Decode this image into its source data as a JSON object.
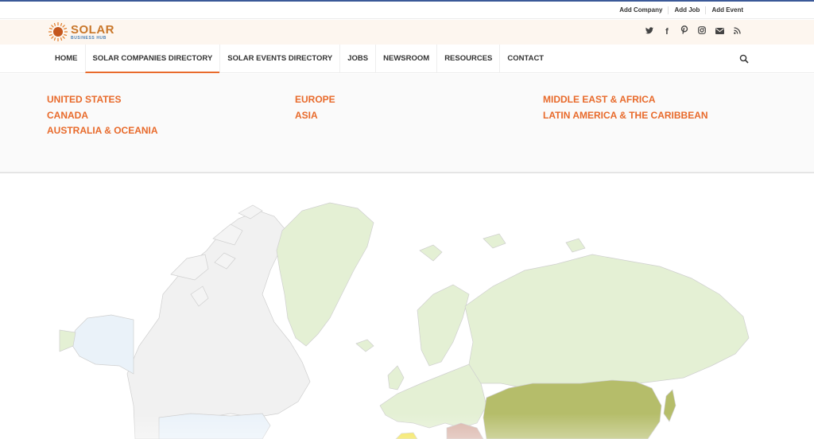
{
  "topbar": {
    "links": [
      "Add Company",
      "Add Job",
      "Add Event"
    ]
  },
  "brand": {
    "name": "SOLAR",
    "tagline": "BUSINESS HUB"
  },
  "social_icons": [
    "twitter-icon",
    "facebook-icon",
    "pinterest-icon",
    "instagram-icon",
    "mail-icon",
    "rss-icon"
  ],
  "nav": {
    "items": [
      "HOME",
      "SOLAR COMPANIES DIRECTORY",
      "SOLAR EVENTS DIRECTORY",
      "JOBS",
      "NEWSROOM",
      "RESOURCES",
      "CONTACT"
    ],
    "active": "SOLAR COMPANIES DIRECTORY"
  },
  "regions": {
    "col1": [
      "UNITED STATES",
      "CANADA",
      "AUSTRALIA & OCEANIA"
    ],
    "col2": [
      "EUROPE",
      "ASIA"
    ],
    "col3": [
      "MIDDLE EAST & AFRICA",
      "LATIN AMERICA & THE CARIBBEAN"
    ]
  },
  "colors": {
    "accent": "#e86a2b",
    "brand": "#c9772a",
    "map_base": "#e4f0d4",
    "map_unlisted": "#f1f1f1",
    "map_usa": "#eaf2f9",
    "map_asia": "#b5bd6a",
    "map_middle_east": "#d9b3a8",
    "map_africa": "#f2e24a"
  }
}
